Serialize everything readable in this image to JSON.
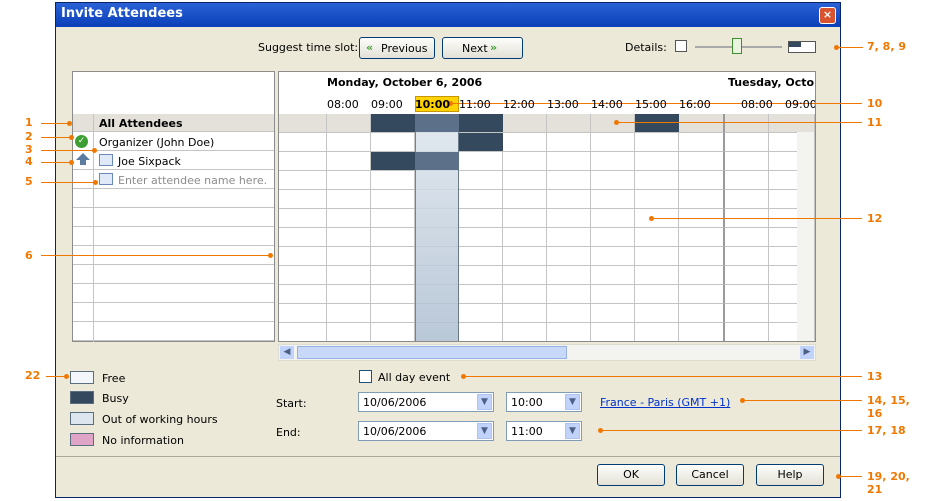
{
  "dialog": {
    "title": "Invite Attendees",
    "close": "×"
  },
  "toolbar": {
    "suggest_label": "Suggest time slot:",
    "previous_label": "Previous",
    "next_label": "Next",
    "details_label": "Details:"
  },
  "attendees": {
    "header": "All Attendees",
    "rows": [
      {
        "name": "Organizer (John Doe)",
        "icon": "check-icon"
      },
      {
        "name": "Joe Sixpack",
        "icon": "arrow-up-icon"
      }
    ],
    "placeholder": "Enter attendee name here."
  },
  "schedule": {
    "day1": "Monday, October 6, 2006",
    "day2": "Tuesday, Octo",
    "hours_day1": [
      "08:00",
      "09:00",
      "10:00",
      "11:00",
      "12:00",
      "13:00",
      "14:00",
      "15:00",
      "16:00"
    ],
    "hours_day2": [
      "08:00",
      "09:00"
    ],
    "selected_hour": "10:00"
  },
  "options": {
    "all_day_label": "All day event",
    "start_label": "Start:",
    "end_label": "End:",
    "start_date": "10/06/2006",
    "start_time": "10:00",
    "end_date": "10/06/2006",
    "end_time": "11:00",
    "timezone": "France - Paris (GMT +1)"
  },
  "legend": {
    "free": "Free",
    "busy": "Busy",
    "out_of_hours": "Out of working hours",
    "no_info": "No information"
  },
  "buttons": {
    "ok": "OK",
    "cancel": "Cancel",
    "help": "Help"
  },
  "callouts": {
    "c1": "1",
    "c2": "2",
    "c3": "3",
    "c4": "4",
    "c5": "5",
    "c6": "6",
    "c789": "7, 8, 9",
    "c10": "10",
    "c11": "11",
    "c12": "12",
    "c13": "13",
    "c141516": "14, 15, 16",
    "c1718": "17, 18",
    "c192021": "19, 20, 21",
    "c22": "22"
  },
  "colors": {
    "busy": "#34495e",
    "selection": "#b7c6d6",
    "accent": "#f07800",
    "title_bar": "#0a3fb8"
  }
}
